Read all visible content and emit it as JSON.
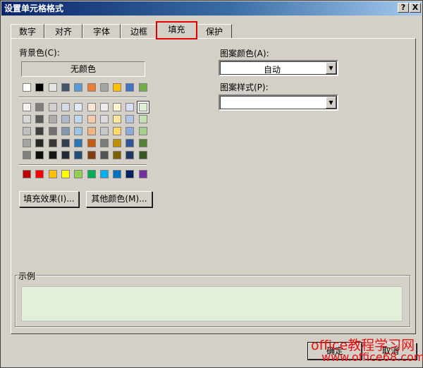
{
  "window": {
    "title": "设置单元格格式",
    "help": "?",
    "close": "X"
  },
  "tabs": [
    {
      "label": "数字"
    },
    {
      "label": "对齐"
    },
    {
      "label": "字体"
    },
    {
      "label": "边框"
    },
    {
      "label": "填充",
      "active": true
    },
    {
      "label": "保护"
    }
  ],
  "fill": {
    "background_label": "背景色(C):",
    "no_color": "无颜色",
    "theme_row": [
      "#ffffff",
      "#000000",
      "#e7e6e6",
      "#44546a",
      "#5b9bd5",
      "#ed7d31",
      "#a5a5a5",
      "#ffc000",
      "#4472c4",
      "#70ad47"
    ],
    "tints": [
      [
        "#f2f2f2",
        "#7f7f7f",
        "#d0cece",
        "#d6dce4",
        "#deebf6",
        "#fbe5d5",
        "#ededed",
        "#fff2cc",
        "#d9e2f3",
        "#e2efd9"
      ],
      [
        "#d8d8d8",
        "#595959",
        "#aeabab",
        "#adb9ca",
        "#bdd7ee",
        "#f7cbac",
        "#dbdbdb",
        "#fee599",
        "#b4c6e7",
        "#c5e0b3"
      ],
      [
        "#bfbfbf",
        "#3f3f3f",
        "#757070",
        "#8496b0",
        "#9cc3e5",
        "#f4b183",
        "#c9c9c9",
        "#ffd965",
        "#8eaadb",
        "#a8d08d"
      ],
      [
        "#a5a5a5",
        "#262626",
        "#3a3838",
        "#323f4f",
        "#2e75b5",
        "#c55a11",
        "#7b7b7b",
        "#bf9000",
        "#2f5496",
        "#538135"
      ],
      [
        "#7f7f7f",
        "#0c0c0c",
        "#171616",
        "#222a35",
        "#1e4e79",
        "#833c0b",
        "#525252",
        "#7f6000",
        "#1f3864",
        "#375623"
      ]
    ],
    "standard_row": [
      "#c00000",
      "#ff0000",
      "#ffc000",
      "#ffff00",
      "#92d050",
      "#00b050",
      "#00b0f0",
      "#0070c0",
      "#002060",
      "#7030a0"
    ],
    "selected": {
      "row": 0,
      "col": 9
    },
    "fill_effects": "填充效果(I)...",
    "more_colors": "其他颜色(M)...",
    "pattern_color_label": "图案颜色(A):",
    "pattern_color_value": "自动",
    "pattern_style_label": "图案样式(P):",
    "pattern_style_value": "",
    "sample_label": "示例",
    "sample_color": "#e2efd9"
  },
  "buttons": {
    "ok": "确定",
    "cancel": "取消"
  },
  "watermark": {
    "line1": "office教程学习网",
    "line2": "www.office68.com"
  }
}
